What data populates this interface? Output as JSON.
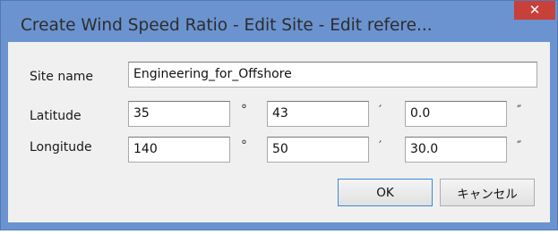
{
  "window": {
    "title": "Create Wind Speed Ratio - Edit Site - Edit refere...",
    "close_glyph": "✕"
  },
  "form": {
    "site_name_label": "Site name",
    "site_name_value": "Engineering_for_Offshore",
    "latitude_label": "Latitude",
    "latitude": {
      "degrees": "35",
      "minutes": "43",
      "seconds": "0.0"
    },
    "longitude_label": "Longitude",
    "longitude": {
      "degrees": "140",
      "minutes": "50",
      "seconds": "30.0"
    },
    "degree_symbol": "°",
    "minute_symbol": "′",
    "second_symbol": "″"
  },
  "buttons": {
    "ok_label": "OK",
    "cancel_label": "キャンセル"
  },
  "colors": {
    "frame": "#6b93cf",
    "close": "#c7403a",
    "default_button_border": "#3b89d8"
  }
}
